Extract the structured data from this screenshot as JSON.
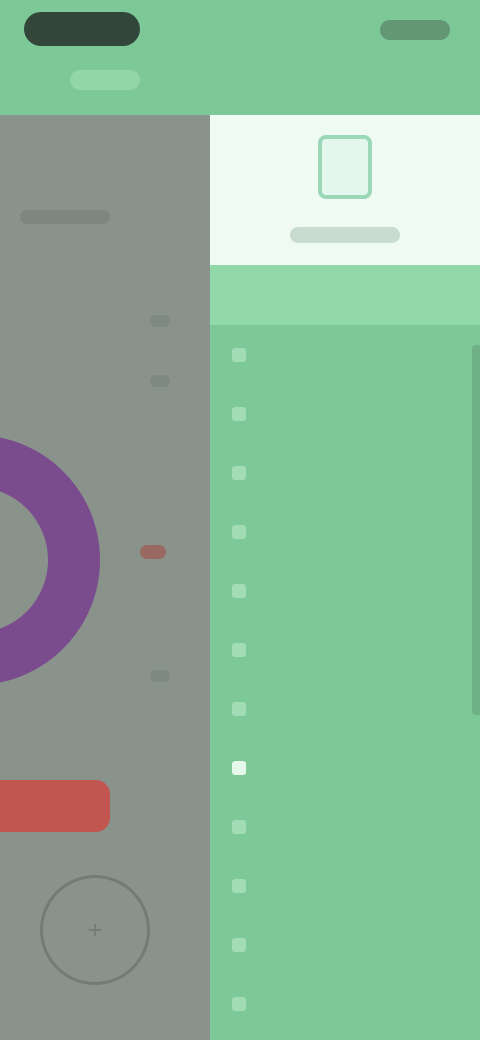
{
  "status_bar": {
    "left_text": "",
    "right_text": ""
  },
  "main": {
    "label": ""
  },
  "drawer": {
    "brand": "",
    "items": [
      {
        "label": "",
        "icon": "home-icon"
      },
      {
        "label": "",
        "icon": "list-icon"
      },
      {
        "label": "",
        "icon": "chart-icon"
      },
      {
        "label": "",
        "icon": "calendar-icon"
      },
      {
        "label": "",
        "icon": "history-icon"
      },
      {
        "label": "",
        "icon": "tag-icon"
      },
      {
        "label": "",
        "icon": "settings-icon"
      },
      {
        "label": "",
        "icon": "backup-icon"
      },
      {
        "label": "",
        "icon": "share-icon"
      },
      {
        "label": "",
        "icon": "star-icon"
      },
      {
        "label": "",
        "icon": "help-icon"
      },
      {
        "label": "",
        "icon": "info-icon"
      }
    ]
  },
  "colors": {
    "accent": "#7cc896",
    "main_overlay": "#8a928c",
    "ring": "#7a4c8e",
    "alert": "#c0564f"
  }
}
